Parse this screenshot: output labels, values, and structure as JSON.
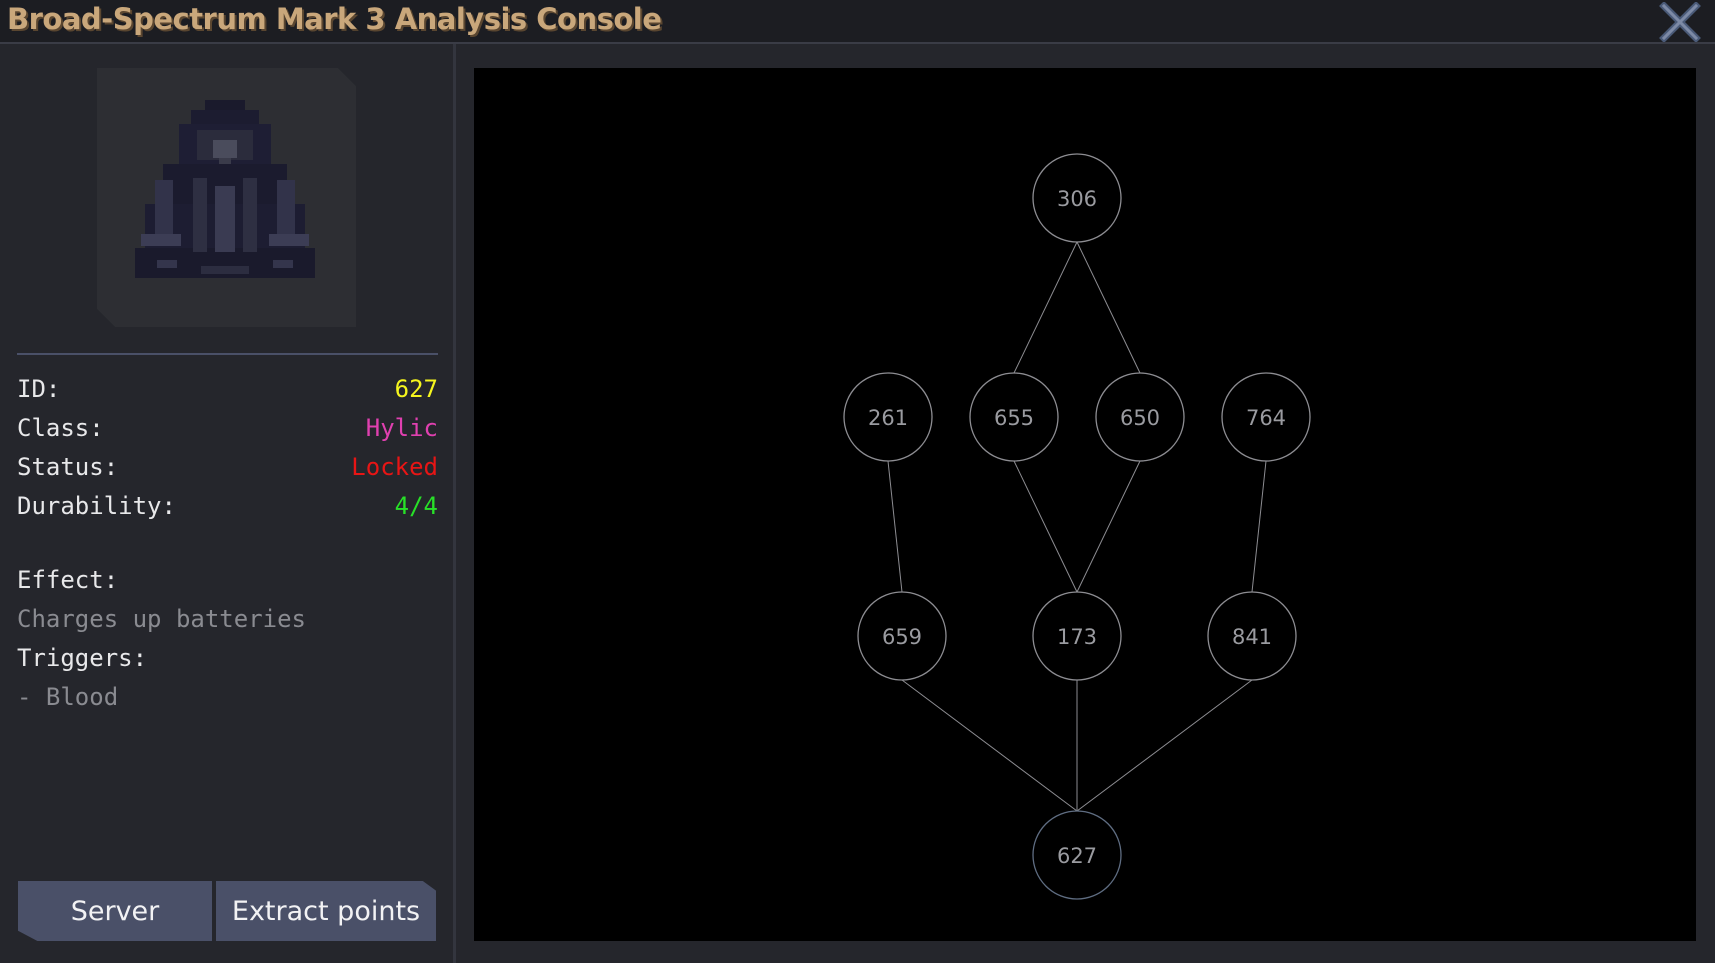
{
  "window": {
    "title": "Broad-Spectrum Mark 3 Analysis Console",
    "close_icon": "close-x-icon"
  },
  "item": {
    "portrait_icon": "robed-figure-sprite",
    "fields": [
      {
        "label": "ID:",
        "value": "627",
        "color": "#f5f51e"
      },
      {
        "label": "Class:",
        "value": "Hylic",
        "color": "#e040b0"
      },
      {
        "label": "Status:",
        "value": "Locked",
        "color": "#e81515"
      },
      {
        "label": "Durability:",
        "value": "4/4",
        "color": "#28e028"
      }
    ],
    "effect_label": "Effect:",
    "effect_text": "Charges up batteries",
    "triggers_label": "Triggers:",
    "triggers": [
      "- Blood"
    ]
  },
  "buttons": {
    "server": "Server",
    "extract": "Extract points"
  },
  "graph": {
    "nodes": [
      {
        "id": "306",
        "tier": 0,
        "slot": 0
      },
      {
        "id": "261",
        "tier": 1,
        "slot": 0
      },
      {
        "id": "655",
        "tier": 1,
        "slot": 1
      },
      {
        "id": "650",
        "tier": 1,
        "slot": 2
      },
      {
        "id": "764",
        "tier": 1,
        "slot": 3
      },
      {
        "id": "659",
        "tier": 2,
        "slot": 0
      },
      {
        "id": "173",
        "tier": 2,
        "slot": 1
      },
      {
        "id": "841",
        "tier": 2,
        "slot": 2
      },
      {
        "id": "627",
        "tier": 3,
        "slot": 0,
        "highlight": true
      }
    ],
    "edges": [
      [
        "306",
        "655"
      ],
      [
        "306",
        "650"
      ],
      [
        "261",
        "659"
      ],
      [
        "655",
        "173"
      ],
      [
        "650",
        "173"
      ],
      [
        "764",
        "841"
      ],
      [
        "659",
        "627"
      ],
      [
        "173",
        "627"
      ],
      [
        "841",
        "627"
      ]
    ]
  }
}
